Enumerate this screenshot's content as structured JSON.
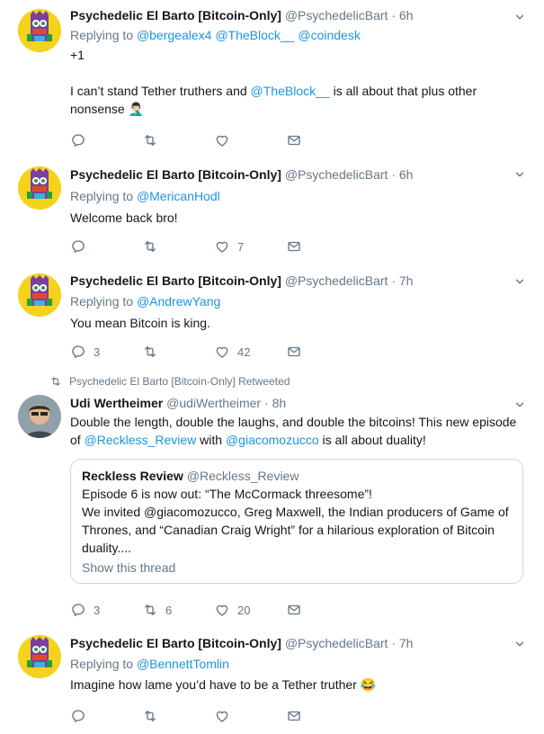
{
  "tweets": [
    {
      "name": "Psychedelic El Barto [Bitcoin-Only]",
      "handle": "@PsychedelicBart",
      "time": "6h",
      "replying_label": "Replying to",
      "replying_to": [
        "@bergealex4",
        "@TheBlock__",
        "@coindesk"
      ],
      "line1": "+1",
      "line2_pre": "I can’t stand Tether truthers and ",
      "line2_mention": "@TheBlock__",
      "line2_post": " is all about that plus other",
      "line3": "nonsense",
      "line3_emoji": "🤦🏻‍♂️",
      "reply_count": "",
      "retweet_count": "",
      "like_count": ""
    },
    {
      "name": "Psychedelic El Barto [Bitcoin-Only]",
      "handle": "@PsychedelicBart",
      "time": "6h",
      "replying_label": "Replying to",
      "replying_to": [
        "@MericanHodl"
      ],
      "text": "Welcome back bro!",
      "reply_count": "",
      "retweet_count": "",
      "like_count": "7"
    },
    {
      "name": "Psychedelic El Barto [Bitcoin-Only]",
      "handle": "@PsychedelicBart",
      "time": "7h",
      "replying_label": "Replying to",
      "replying_to": [
        "@AndrewYang"
      ],
      "text": "You mean Bitcoin is king.",
      "reply_count": "3",
      "retweet_count": "",
      "like_count": "42"
    },
    {
      "retweet_context": "Psychedelic El Barto [Bitcoin-Only] Retweeted",
      "name": "Udi Wertheimer",
      "handle": "@udiWertheimer",
      "time": "8h",
      "line1": "Double the length, double the laughs, and double the bitcoins! This new episode",
      "line2_pre": "of ",
      "line2_mention1": "@Reckless_Review",
      "line2_mid": " with ",
      "line2_mention2": "@giacomozucco",
      "line2_post": " is all about duality!",
      "quote": {
        "name": "Reckless Review",
        "handle": "@Reckless_Review",
        "lines": [
          "Episode 6 is now out: “The McCormack threesome”!",
          "We invited @giacomozucco, Greg Maxwell, the Indian producers of Game of",
          "Thrones, and “Canadian Craig Wright” for a hilarious exploration of Bitcoin",
          "duality...."
        ],
        "show_thread": "Show this thread"
      },
      "reply_count": "3",
      "retweet_count": "6",
      "like_count": "20"
    },
    {
      "name": "Psychedelic El Barto [Bitcoin-Only]",
      "handle": "@PsychedelicBart",
      "time": "7h",
      "replying_label": "Replying to",
      "replying_to": [
        "@BennettTomlin"
      ],
      "text": "Imagine how lame you’d have to be a Tether truther",
      "emoji": "😂",
      "reply_count": "",
      "retweet_count": "",
      "like_count": ""
    }
  ],
  "dot": "·",
  "colors": {
    "link": "#1b95e0",
    "muted": "#657786",
    "avatar_bg": "#f5d31c"
  }
}
